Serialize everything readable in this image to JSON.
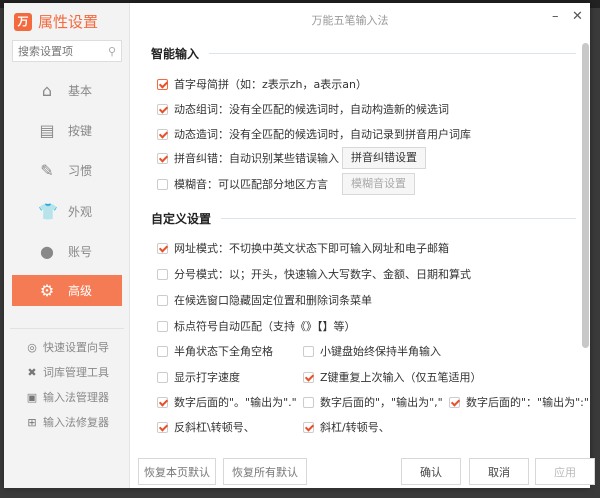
{
  "window": {
    "title": "万能五笔输入法",
    "minimize": "–",
    "close": "✕"
  },
  "sidebar": {
    "logo_mark": "万",
    "title": "属性设置",
    "search_placeholder": "搜索设置项",
    "items": [
      {
        "label": "基本",
        "icon": "home-icon"
      },
      {
        "label": "按键",
        "icon": "keyboard-icon"
      },
      {
        "label": "习惯",
        "icon": "pencil-icon"
      },
      {
        "label": "外观",
        "icon": "shirt-icon"
      },
      {
        "label": "账号",
        "icon": "user-icon"
      },
      {
        "label": "高级",
        "icon": "gear-icon",
        "active": true
      }
    ],
    "tools": [
      {
        "label": "快速设置向导"
      },
      {
        "label": "词库管理工具"
      },
      {
        "label": "输入法管理器"
      },
      {
        "label": "输入法修复器"
      }
    ]
  },
  "smart": {
    "heading": "智能输入",
    "items": [
      {
        "label": "首字母简拼（如：z表示zh，a表示an）",
        "checked": true
      },
      {
        "label": "动态组词：没有全匹配的候选词时，自动构造新的候选词",
        "checked": true
      },
      {
        "label": "动态造词：没有全匹配的候选词时，自动记录到拼音用户词库",
        "checked": true
      },
      {
        "label": "拼音纠错：自动识别某些错误输入",
        "checked": true,
        "button": "拼音纠错设置"
      },
      {
        "label": "模糊音：可以匹配部分地区方言",
        "checked": false,
        "button": "模糊音设置"
      }
    ]
  },
  "custom": {
    "heading": "自定义设置",
    "items": [
      {
        "label": "网址模式：不切换中英文状态下即可输入网址和电子邮箱",
        "checked": true
      },
      {
        "label": "分号模式：以；开头，快速输入大写数字、金额、日期和算式",
        "checked": false
      },
      {
        "label": "在候选窗口隐藏固定位置和删除词条菜单",
        "checked": false
      },
      {
        "label": "标点符号自动匹配（支持《》【】等）",
        "checked": false
      },
      {
        "label": "半角状态下全角空格",
        "checked": false
      },
      {
        "label": "小键盘始终保持半角输入",
        "checked": false
      },
      {
        "label": "显示打字速度",
        "checked": false
      },
      {
        "label": "Z键重复上次输入（仅五笔适用）",
        "checked": true
      },
      {
        "label": "数字后面的\"。\"输出为\".\"",
        "checked": true
      },
      {
        "label": "数字后面的\"，\"输出为\",\"",
        "checked": false
      },
      {
        "label": "数字后面的\"：\"输出为\":\"",
        "checked": true
      },
      {
        "label": "反斜杠\\转顿号、",
        "checked": true
      },
      {
        "label": "斜杠/转顿号、",
        "checked": true
      }
    ]
  },
  "footer": {
    "reset_page": "恢复本页默认",
    "reset_all": "恢复所有默认",
    "ok": "确认",
    "cancel": "取消",
    "apply": "应用"
  }
}
